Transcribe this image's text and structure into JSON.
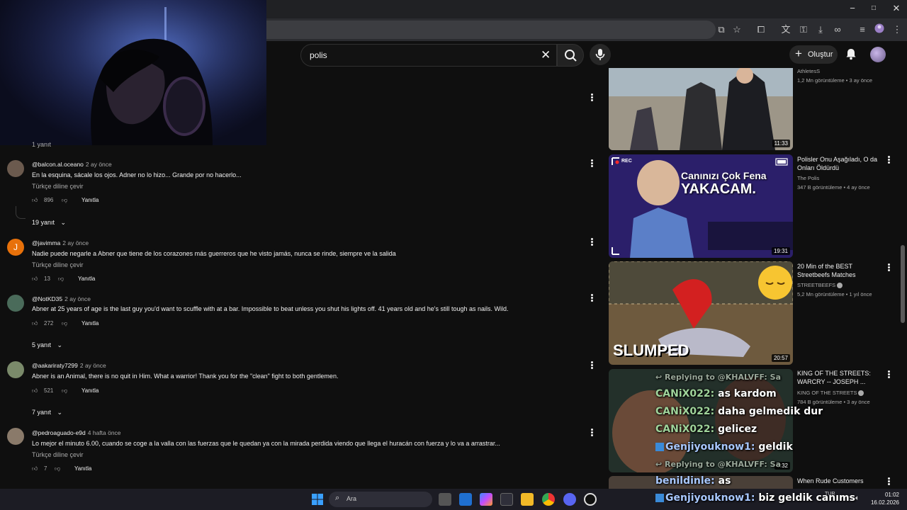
{
  "browser": {
    "window_controls": [
      "−",
      "□",
      "✕"
    ],
    "toolbar_icons": [
      "install-icon",
      "star-icon",
      "extensions-icon",
      "translate-icon",
      "password-icon",
      "download-icon",
      "link-icon",
      "reading-list-icon",
      "profile-icon",
      "menu-icon"
    ]
  },
  "header": {
    "search_value": "polis",
    "create_label": "Oluştur"
  },
  "comments": [
    {
      "user": "@balcon.al.oceano",
      "time": "2 ay önce",
      "text": "En la esquina, sácale los ojos. Adner no lo hizo... Grande por no hacerlo...",
      "translate": "Türkçe diline çevir",
      "likes": "896",
      "reply": "Yanıtla",
      "replies": "19 yanıt",
      "avatar_color": "#6b5a4e"
    },
    {
      "user": "@javimma",
      "time": "2 ay önce",
      "text": "Nadie puede negarle a Abner que tiene de los corazones más guerreros que he visto jamás, nunca se rinde, siempre ve la salida",
      "translate": "Türkçe diline çevir",
      "likes": "13",
      "reply": "Yanıtla",
      "avatar_letter": "J",
      "avatar_color": "#e8710a"
    },
    {
      "user": "@NotKD35",
      "time": "2 ay önce",
      "text": "Abner at 25 years of age is the last guy you'd want to scuffle with at a bar. Impossible to beat unless you shut his lights off. 41 years old and he's still tough as nails. Wild.",
      "likes": "272",
      "reply": "Yanıtla",
      "replies": "5 yanıt",
      "avatar_color": "#4a6b5a"
    },
    {
      "user": "@aakariraty7299",
      "time": "2 ay önce",
      "text": "Abner is an Animal, there is no quit in Him. What a warrior! Thank you for the \"clean\" fight to both gentlemen.",
      "likes": "521",
      "reply": "Yanıtla",
      "replies": "7 yanıt",
      "avatar_color": "#7a8a6a"
    },
    {
      "user": "@pedroaguado-e9d",
      "time": "4 hafta önce",
      "text": "Lo mejor el minuto 6.00, cuando se coge a la valla con las fuerzas que le quedan ya  con la mirada  perdida viendo que llega el huracán con fuerza y lo va a arrastrar...",
      "translate": "Türkçe diline çevir",
      "likes": "7",
      "reply": "Yanıtla",
      "avatar_color": "#8a7a6a"
    }
  ],
  "partial_reply_label": "1 yanıt",
  "videos": [
    {
      "title": "",
      "channel": "AthletesS",
      "meta": "1,2 Mn görüntüleme • 3 ay önce",
      "duration": "11:33"
    },
    {
      "title": "Polisler Onu Aşağıladı, O da Onları Öldürdü",
      "channel": "The Polis",
      "meta": "347 B görüntüleme • 4 ay önce",
      "duration": "19:31",
      "thumb_text_1": "Canınızı Çok Fena",
      "thumb_text_2": "YAKACAM.",
      "rec": "REC"
    },
    {
      "title": "20 Min of the BEST Streetbeefs Matches",
      "channel": "STREETBEEFS",
      "meta": "5,2 Mn görüntüleme • 1 yıl önce",
      "duration": "20:57",
      "thumb_text": "SLUMPED"
    },
    {
      "title": "KING OF THE STREETS: WARCRY -- JOSEPH ...",
      "channel": "KING OF THE STREETS",
      "meta": "784 B görüntüleme • 3 ay önce",
      "duration": "7:32"
    },
    {
      "title": "When Rude Customers"
    }
  ],
  "chat_overlay": [
    {
      "user": "Replying to @KHALVFF: Sa",
      "kind": "reply"
    },
    {
      "user": "CANiX022:",
      "msg": "as kardom"
    },
    {
      "user": "CANiX022:",
      "msg": "daha gelmedik dur"
    },
    {
      "user": "CANiX022:",
      "msg": "gelicez"
    },
    {
      "user": "Genjiyouknow1:",
      "msg": "geldik"
    },
    {
      "user": "Replying to @KHALVFF: Sa",
      "kind": "reply"
    },
    {
      "user": "benildinle:",
      "msg": "as"
    },
    {
      "user": "Genjiyouknow1:",
      "msg": "biz geldik canıms"
    }
  ],
  "taskbar": {
    "search_placeholder": "Ara",
    "lang": "TUR",
    "time": "01:02",
    "date": "16.02.2026"
  }
}
